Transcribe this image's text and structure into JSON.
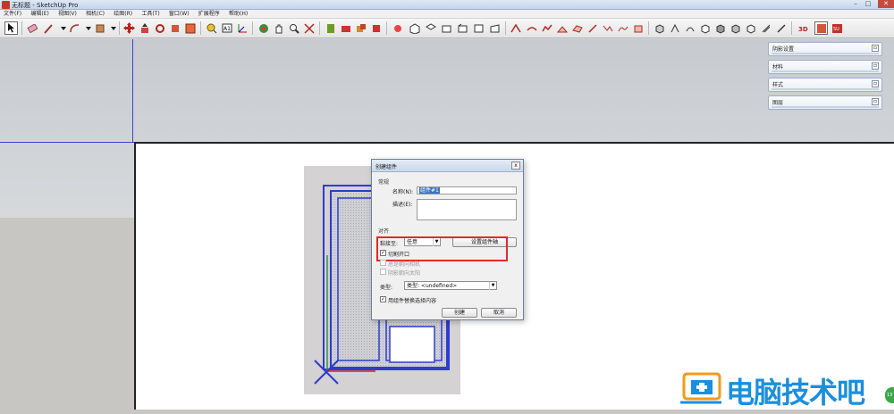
{
  "window": {
    "title": "无标题 - SketchUp Pro",
    "minimize": "–",
    "maximize": "□",
    "close": "✕"
  },
  "menu": [
    "文件(F)",
    "编辑(E)",
    "视图(V)",
    "相机(C)",
    "绘图(R)",
    "工具(T)",
    "窗口(W)",
    "扩展程序",
    "帮助(H)"
  ],
  "tray": [
    {
      "label": "阴影设置"
    },
    {
      "label": "材料"
    },
    {
      "label": "样式"
    },
    {
      "label": "图层"
    }
  ],
  "dialog": {
    "title": "创建组件",
    "close": "x",
    "section_general": "常规",
    "name_label": "名称(N):",
    "name_value": "组件#1",
    "desc_label": "描述(E):",
    "desc_value": "",
    "section_align": "对齐",
    "glue_label": "黏接至:",
    "glue_value": "任意",
    "set_axes": "设置组件轴",
    "cut_opening": "切割开口",
    "always_face": "总是朝向相机",
    "shadows_face": "阴影朝向太阳",
    "type_label": "类型:",
    "type_value": "类型: <undefined>",
    "replace_sel": "用组件替换选择内容",
    "create": "创建",
    "cancel": "取消"
  },
  "watermark": {
    "text": "电脑技术吧"
  },
  "side_badge": "13",
  "colors": {
    "accent": "#1a8fe0",
    "highlight": "#e02b2b",
    "axis_blue": "#3a45c8"
  }
}
